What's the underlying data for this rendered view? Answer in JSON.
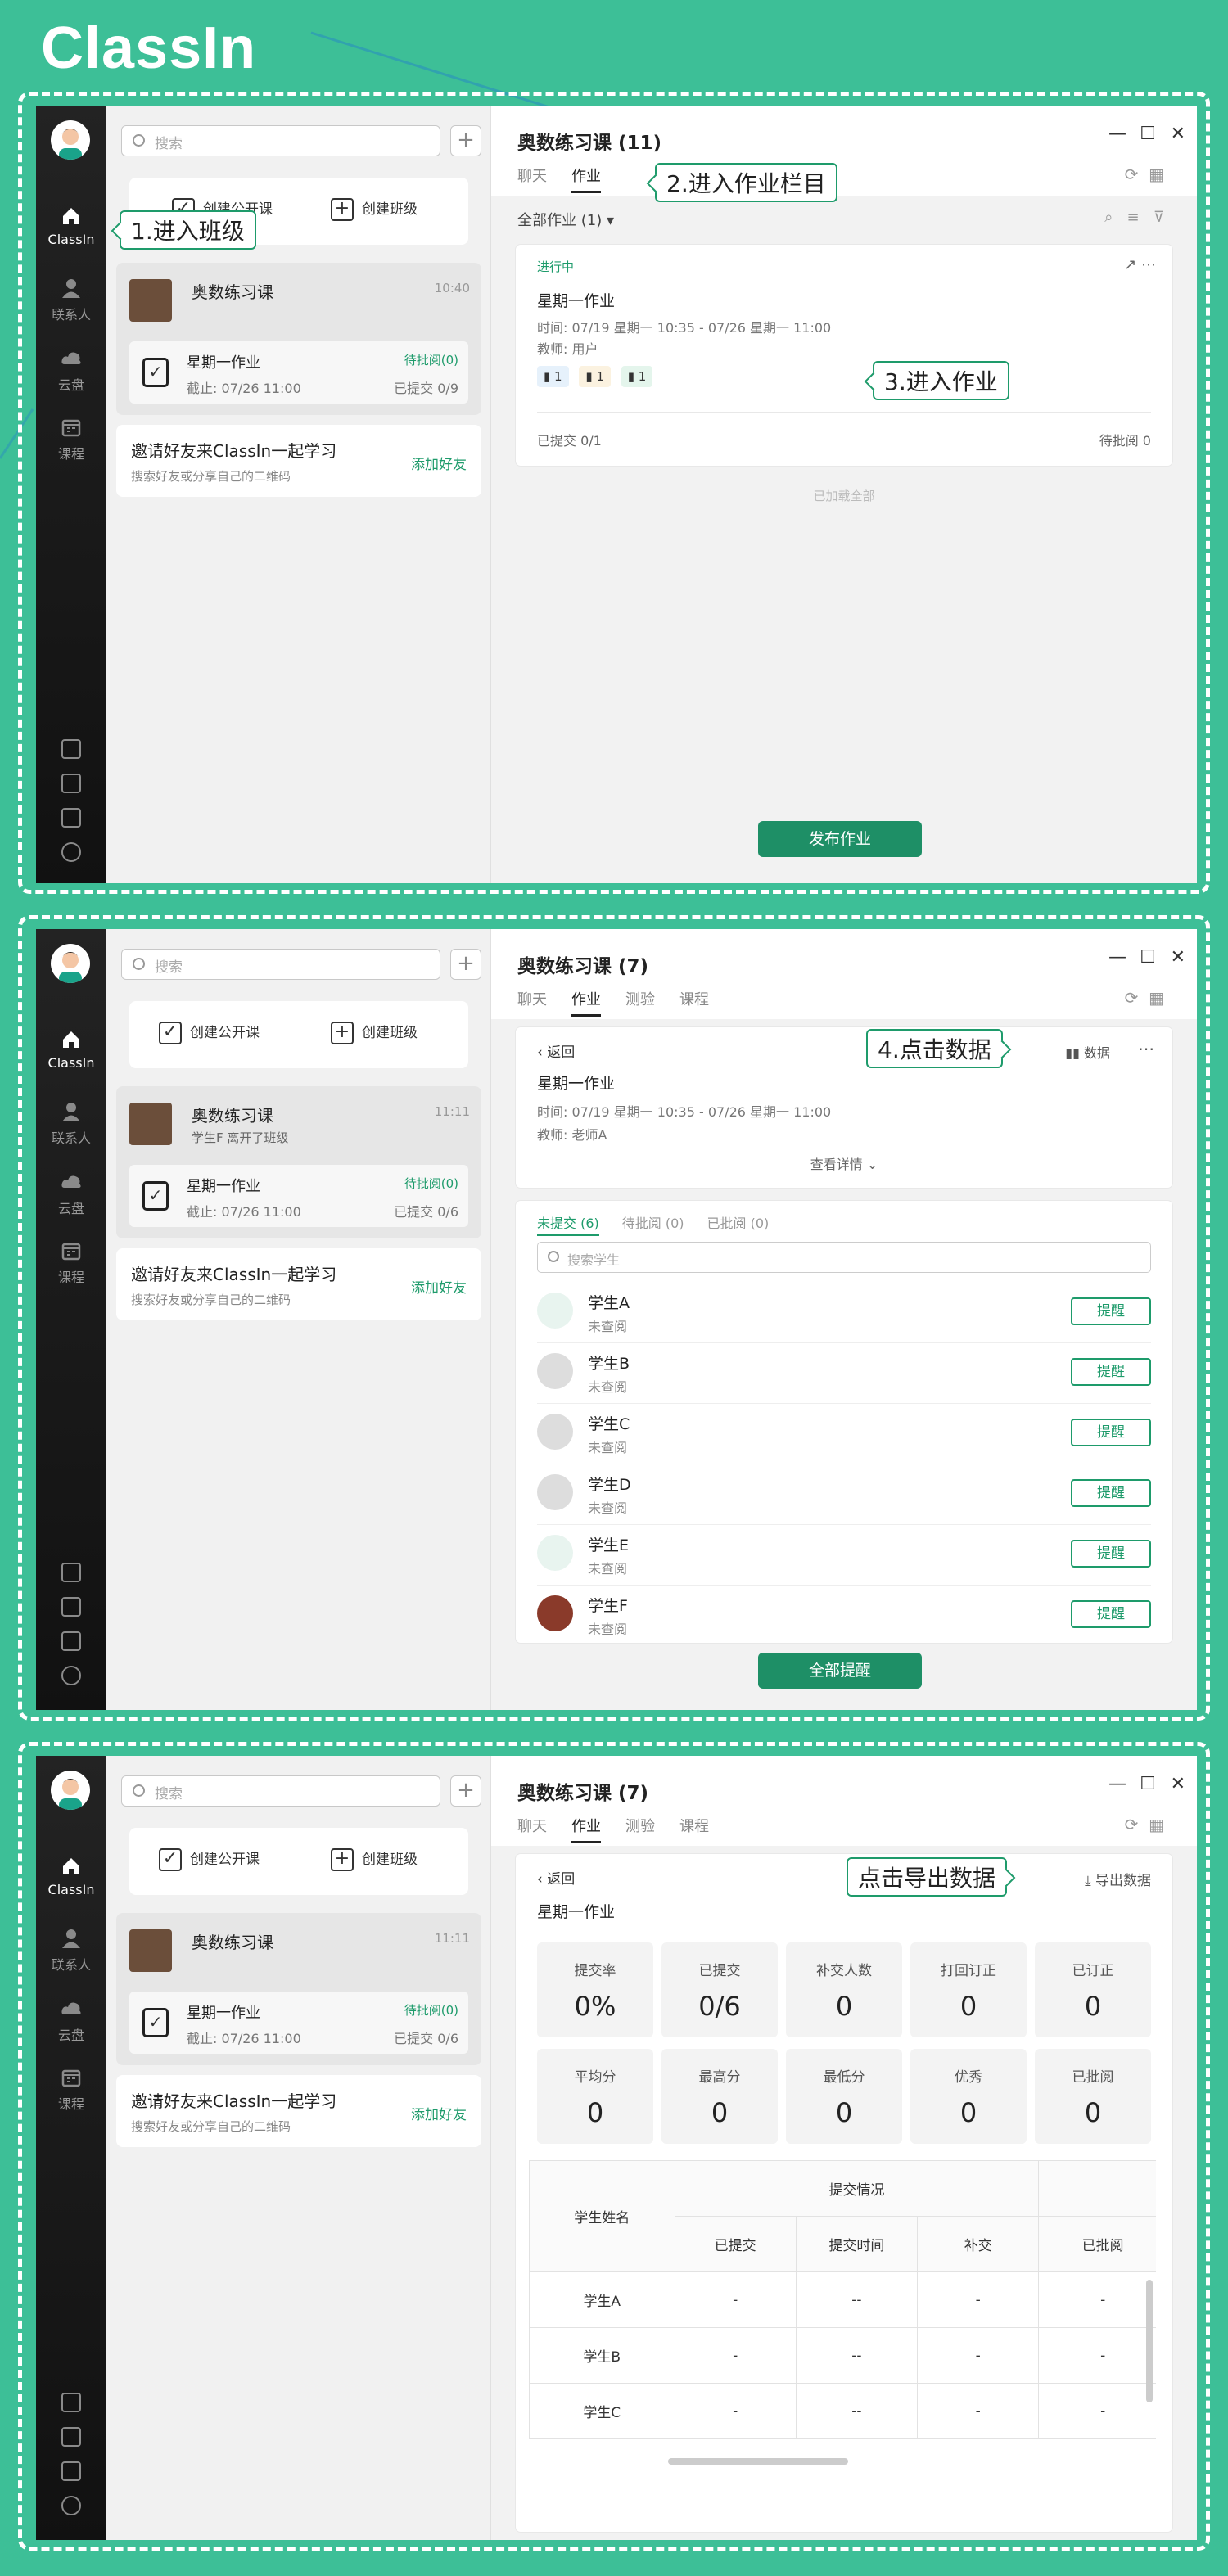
{
  "logo": "ClassIn",
  "rail": {
    "classin": "ClassIn",
    "contacts": "联系人",
    "cloud": "云盘",
    "course": "课程"
  },
  "list": {
    "search_placeholder": "搜索",
    "create_public_class": "创建公开课",
    "create_class": "创建班级",
    "class_name": "奥数练习课",
    "invite_title": "邀请好友来ClassIn一起学习",
    "invite_sub": "搜索好友或分享自己的二维码",
    "invite_add": "添加好友",
    "homework_name": "星期一作业",
    "homework_due": "截止: 07/26 11:00",
    "pending": "待批阅(0)"
  },
  "panel1": {
    "class_time": "10:40",
    "hw_submitted": "已提交 0/9",
    "title": "奥数练习课 (11)",
    "tabs": [
      "聊天",
      "作业"
    ],
    "filter": "全部作业 (1)",
    "status": "进行中",
    "hw_title": "星期一作业",
    "hw_time": "时间: 07/19 星期一 10:35 - 07/26 星期一 11:00",
    "hw_teacher": "教师: 用户",
    "attachments": [
      "1",
      "1",
      "1"
    ],
    "submitted": "已提交 0/1",
    "pending_review": "待批阅 0",
    "loaded_all": "已加载全部",
    "publish": "发布作业",
    "callout1": "1.进入班级",
    "callout2": "2.进入作业栏目",
    "callout3": "3.进入作业"
  },
  "panel2": {
    "class_time": "11:11",
    "class_sub": "学生F 离开了班级",
    "hw_submitted": "已提交 0/6",
    "title": "奥数练习课 (7)",
    "tabs": [
      "聊天",
      "作业",
      "测验",
      "课程"
    ],
    "back": "返回",
    "data_btn": "数据",
    "hw_title": "星期一作业",
    "hw_time": "时间: 07/19 星期一 10:35 - 07/26 星期一 11:00",
    "hw_teacher": "教师: 老师A",
    "view_details": "查看详情",
    "subtabs": [
      "未提交 (6)",
      "待批阅 (0)",
      "已批阅 (0)"
    ],
    "search_students": "搜索学生",
    "students": [
      {
        "name": "学生A",
        "status": "未查阅",
        "action": "提醒"
      },
      {
        "name": "学生B",
        "status": "未查阅",
        "action": "提醒"
      },
      {
        "name": "学生C",
        "status": "未查阅",
        "action": "提醒"
      },
      {
        "name": "学生D",
        "status": "未查阅",
        "action": "提醒"
      },
      {
        "name": "学生E",
        "status": "未查阅",
        "action": "提醒"
      },
      {
        "name": "学生F",
        "status": "未查阅",
        "action": "提醒"
      }
    ],
    "remind_all": "全部提醒",
    "callout4": "4.点击数据"
  },
  "panel3": {
    "class_time": "11:11",
    "hw_submitted": "已提交 0/6",
    "title": "奥数练习课 (7)",
    "tabs": [
      "聊天",
      "作业",
      "测验",
      "课程"
    ],
    "back": "返回",
    "export": "导出数据",
    "hw_title": "星期一作业",
    "stats": [
      {
        "label": "提交率",
        "value": "0%"
      },
      {
        "label": "已提交",
        "value": "0/6"
      },
      {
        "label": "补交人数",
        "value": "0"
      },
      {
        "label": "打回订正",
        "value": "0"
      },
      {
        "label": "已订正",
        "value": "0"
      },
      {
        "label": "平均分",
        "value": "0"
      },
      {
        "label": "最高分",
        "value": "0"
      },
      {
        "label": "最低分",
        "value": "0"
      },
      {
        "label": "优秀",
        "value": "0"
      },
      {
        "label": "已批阅",
        "value": "0"
      }
    ],
    "table": {
      "name_header": "学生姓名",
      "group_header": "提交情况",
      "columns": [
        "已提交",
        "提交时间",
        "补交",
        "已批阅"
      ],
      "rows": [
        {
          "name": "学生A",
          "cells": [
            "-",
            "--",
            "-",
            "-"
          ]
        },
        {
          "name": "学生B",
          "cells": [
            "-",
            "--",
            "-",
            "-"
          ]
        },
        {
          "name": "学生C",
          "cells": [
            "-",
            "--",
            "-",
            "-"
          ]
        }
      ]
    },
    "callout5": "点击导出数据"
  },
  "window_controls": [
    "—",
    "☐",
    "✕"
  ],
  "colors": {
    "brand_green": "#1e8f66",
    "background": "#3dbf97",
    "rail": "#1a1a1a"
  }
}
